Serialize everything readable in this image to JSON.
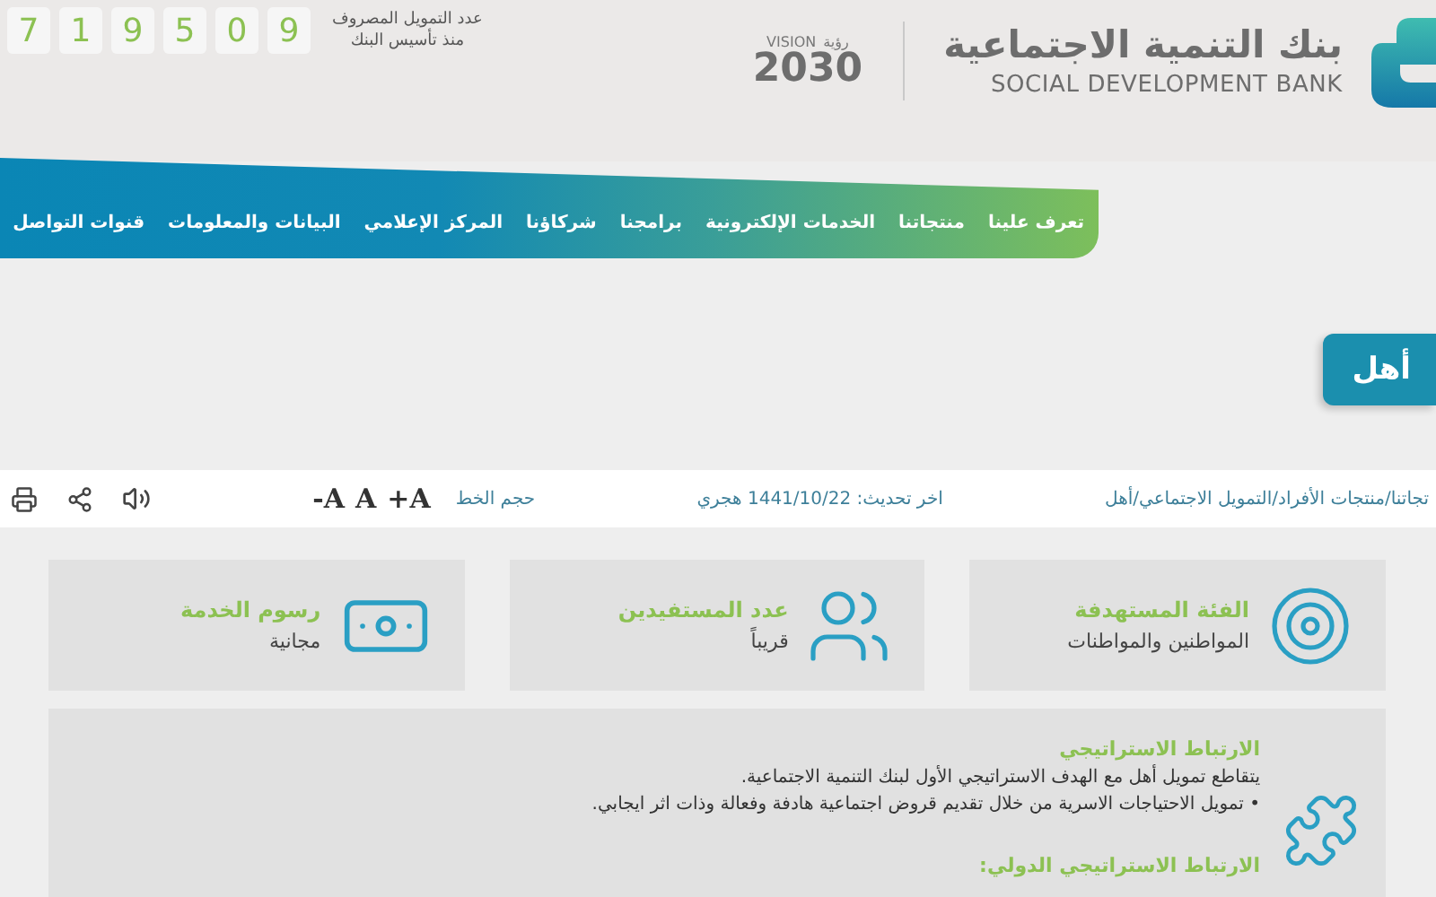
{
  "header": {
    "bank_name_ar": "بنك التنمية الاجتماعية",
    "bank_name_en": "SOCIAL DEVELOPMENT BANK",
    "vision_en": "VISION",
    "vision_ar": "رؤية",
    "vision_year": "2030",
    "counter_label": [
      "عدد التمويل المصروف",
      "منذ تأسيس البنك"
    ],
    "counter_digits": [
      "9",
      "0",
      "5",
      "9",
      "1",
      "7"
    ]
  },
  "nav": {
    "items": [
      "تعرف علينا",
      "منتجاتنا",
      "الخدمات الإلكترونية",
      "برامجنا",
      "شركاؤنا",
      "المركز الإعلامي",
      "البيانات والمعلومات",
      "قنوات التواصل"
    ]
  },
  "page_title": "أهل",
  "toolbar": {
    "breadcrumb": "تجاتنا/منتجات الأفراد/التمويل الاجتماعي/أهل",
    "last_update": "اخر تحديث: 1441/10/22 هجري",
    "font_size_label": "حجم الخط",
    "font_buttons": [
      "+A",
      "A",
      "-A"
    ]
  },
  "cards": [
    {
      "kind": "target",
      "title": "الفئة المستهدفة",
      "value": "المواطنين والمواطنات"
    },
    {
      "kind": "people",
      "title": "عدد المستفيدين",
      "value": "قريباً"
    },
    {
      "kind": "money",
      "title": "رسوم الخدمة",
      "value": "مجانية"
    }
  ],
  "panel": {
    "sections": [
      {
        "heading": "الارتباط الاستراتيجي",
        "lines": [
          "يتقاطع تمويل أهل مع الهدف الاستراتيجي الأول لبنك التنمية الاجتماعية.",
          "• تمويل الاحتياجات الاسرية من خلال تقديم قروض اجتماعية هادفة وفعالة وذات اثر ايجابي."
        ]
      },
      {
        "heading": "الارتباط الاستراتيجي الدولي:"
      }
    ]
  }
}
